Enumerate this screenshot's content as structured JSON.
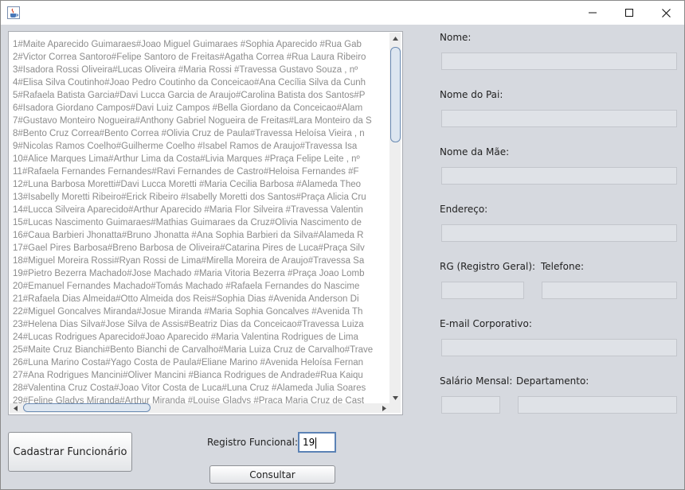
{
  "window": {
    "icons": {
      "app": "java-cup-icon",
      "minimize": "minimize-icon",
      "maximize": "maximize-icon",
      "close": "close-icon"
    }
  },
  "records": [
    "1#Maite Aparecido Guimaraes#Joao Miguel Guimaraes  #Sophia Aparecido  #Rua Gab",
    "2#Victor Correa Santoro#Felipe Santoro de Freitas#Agatha Correa  #Rua Laura Ribeiro",
    "3#Isadora Rossi Oliveira#Lucas Oliveira  #Maria Rossi  #Travessa Gustavo Souza  , nº",
    "4#Elisa Silva Coutinho#Joao Pedro Coutinho da Conceicao#Ana Cecília Silva da Cunh",
    "5#Rafaela Batista Garcia#Davi Lucca Garcia de Araujo#Carolina Batista dos Santos#P",
    "6#Isadora Giordano Campos#Davi Luiz Campos  #Bella Giordano da Conceicao#Alam",
    "7#Gustavo Monteiro Nogueira#Anthony Gabriel Nogueira de Freitas#Lara Monteiro da S",
    "8#Bento Cruz Correa#Bento Correa  #Olivia Cruz de Paula#Travessa Heloísa Vieira  , n",
    "9#Nicolas Ramos Coelho#Guilherme Coelho  #Isabel Ramos de Araujo#Travessa Isa",
    "10#Alice Marques Lima#Arthur Lima da Costa#Livia Marques  #Praça Felipe Leite  , nº",
    "11#Rafaela Fernandes Fernandes#Ravi Fernandes de Castro#Heloisa Fernandes  #F",
    "12#Luna Barbosa Moretti#Davi Lucca Moretti  #Maria Cecilia Barbosa  #Alameda Theo",
    "13#Isabelly Moretti Ribeiro#Erick Ribeiro  #Isabelly Moretti dos Santos#Praça Alicia Cru",
    "14#Lucca Silveira Aparecido#Arthur Aparecido  #Maria Flor Silveira  #Travessa Valentin",
    "15#Lucas Nascimento Guimaraes#Mathias Guimaraes da Cruz#Olivia Nascimento de",
    "16#Caua Barbieri Jhonatta#Bruno Jhonatta  #Ana Sophia Barbieri da Silva#Alameda R",
    "17#Gael Pires Barbosa#Breno Barbosa de Oliveira#Catarina Pires de Luca#Praça Silv",
    "18#Miguel Moreira Rossi#Ryan Rossi de Lima#Mirella Moreira de Araujo#Travessa Sa",
    "19#Pietro Bezerra Machado#Jose Machado  #Maria Vitoria Bezerra  #Praça Joao Lomb",
    "20#Emanuel Fernandes Machado#Tomás Machado  #Rafaela Fernandes do Nascime",
    "21#Rafaela Dias Almeida#Otto Almeida dos Reis#Sophia Dias  #Avenida Anderson Di",
    "22#Miguel Goncalves Miranda#Josue Miranda  #Maria Sophia Goncalves  #Avenida Th",
    "23#Helena Dias Silva#Jose Silva de Assis#Beatriz Dias da Conceicao#Travessa Luiza",
    "24#Lucas Rodrigues Aparecido#Joao Aparecido  #Maria Valentina Rodrigues de Lima",
    "25#Maite Cruz Bianchi#Bento Bianchi de Carvalho#Maria Luiza Cruz de Carvalho#Trave",
    "26#Luna Marino Costa#Yago Costa de Paula#Eliane Marino  #Avenida Heloísa Fernan",
    "27#Ana Rodrigues Mancini#Oliver Mancini  #Bianca Rodrigues de Andrade#Rua Kaiqu",
    "28#Valentina Cruz Costa#Joao Vitor Costa de Luca#Luna Cruz  #Alameda Julia Soares",
    "29#Feline Gladys Miranda#Arthur Miranda  #Louise Gladys  #Praca Maria Cruz de Cast"
  ],
  "form": {
    "nome_label": "Nome:",
    "nome_pai_label": "Nome do Pai:",
    "nome_mae_label": "Nome da Mãe:",
    "endereco_label": "Endereço:",
    "rg_label": "RG (Registro Geral):",
    "telefone_label": "Telefone:",
    "email_label": "E-mail Corporativo:",
    "salario_label": "Salário Mensal:",
    "departamento_label": "Departamento:"
  },
  "actions": {
    "cadastrar_label": "Cadastrar Funcionário",
    "registro_label": "Registro Funcional:",
    "registro_value": "19",
    "consultar_label": "Consultar"
  }
}
